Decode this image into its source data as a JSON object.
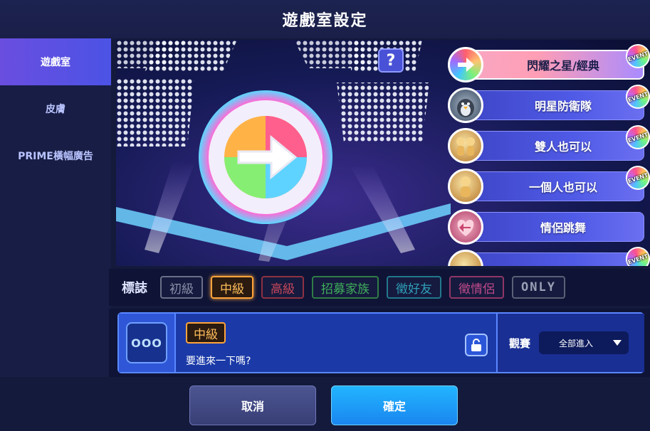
{
  "title": "遊戲室設定",
  "sidebar": {
    "items": [
      {
        "label": "遊戲室",
        "active": true
      },
      {
        "label": "皮膚",
        "active": false
      },
      {
        "label": "PRIME橫幅廣告",
        "active": false
      }
    ]
  },
  "preview": {
    "help_label": "?",
    "modes": [
      {
        "label": "閃耀之星/經典",
        "icon": "rainbow-arrow-icon",
        "event": "EVENT",
        "selected": true
      },
      {
        "label": "明星防衛隊",
        "icon": "penguin-icon",
        "event": "EVENT",
        "selected": false
      },
      {
        "label": "雙人也可以",
        "icon": "twin-dancers-icon",
        "event": "EVENT",
        "selected": false
      },
      {
        "label": "一個人也可以",
        "icon": "solo-dancer-icon",
        "event": "EVENT",
        "selected": false
      },
      {
        "label": "情侶跳舞",
        "icon": "heart-arrow-icon",
        "event": "",
        "selected": false
      },
      {
        "label": "",
        "icon": "partial-mode-icon",
        "event": "EVENT",
        "selected": false
      }
    ]
  },
  "tags": {
    "label": "標誌",
    "items": [
      {
        "label": "初級",
        "color": "#8a8fa8",
        "selected": false
      },
      {
        "label": "中級",
        "color": "#ffa43a",
        "selected": true
      },
      {
        "label": "高級",
        "color": "#c8475b",
        "selected": false
      },
      {
        "label": "招募家族",
        "color": "#3fae5a",
        "selected": false
      },
      {
        "label": "徵好友",
        "color": "#2e9fb8",
        "selected": false
      },
      {
        "label": "徵情侶",
        "color": "#c04a8a",
        "selected": false
      },
      {
        "label": "ONLY",
        "color": "#9aa0b4",
        "selected": false
      }
    ]
  },
  "room": {
    "avatar_text": "OOO",
    "tag": "中級",
    "message": "要進來一下嗎?",
    "watch_label": "觀賽",
    "watch_value": "全部進入"
  },
  "buttons": {
    "cancel": "取消",
    "confirm": "確定"
  },
  "colors": {
    "accent": "#4b53e5",
    "confirm": "#1a9cf5",
    "tag_active": "#ffa43a"
  }
}
